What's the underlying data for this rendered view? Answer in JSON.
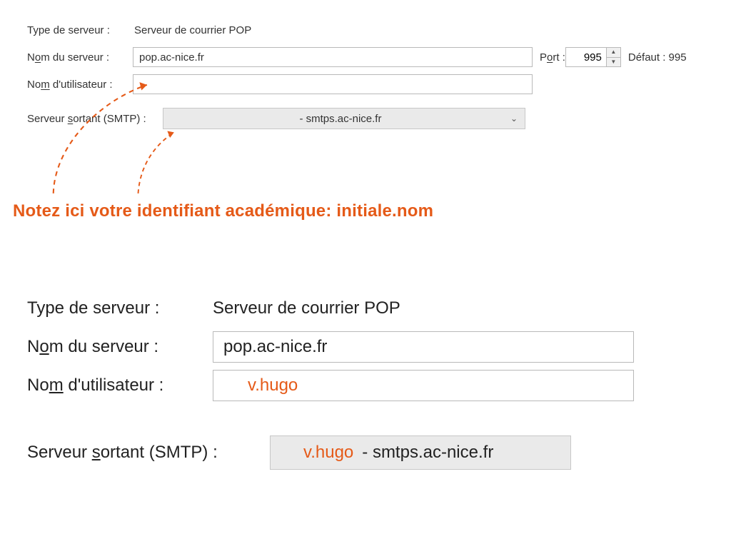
{
  "top": {
    "server_type_label": "Type de serveur :",
    "server_type_value": "Serveur de courrier POP",
    "server_name_label_pre": "N",
    "server_name_label_under": "o",
    "server_name_label_post": "m du serveur :",
    "server_name_value": "pop.ac-nice.fr",
    "port_label_pre": "P",
    "port_label_under": "o",
    "port_label_post": "rt :",
    "port_value": "995",
    "default_label": "Défaut : 995",
    "username_label_pre": "No",
    "username_label_under": "m",
    "username_label_post": " d'utilisateur :",
    "username_value": "",
    "smtp_label_pre": "Serveur ",
    "smtp_label_under": "s",
    "smtp_label_post": "ortant (SMTP) :",
    "smtp_value": " - smtps.ac-nice.fr"
  },
  "annotation": "Notez ici votre identifiant académique: initiale.nom",
  "bottom": {
    "server_type_label": "Type de serveur :",
    "server_type_value": "Serveur de courrier POP",
    "server_name_label_pre": "N",
    "server_name_label_under": "o",
    "server_name_label_post": "m du serveur :",
    "server_name_value": "pop.ac-nice.fr",
    "username_label_pre": "No",
    "username_label_under": "m",
    "username_label_post": " d'utilisateur :",
    "username_value": "v.hugo",
    "smtp_label_pre": "Serveur ",
    "smtp_label_under": "s",
    "smtp_label_post": "ortant (SMTP) :",
    "smtp_user": "v.hugo",
    "smtp_rest": "- smtps.ac-nice.fr"
  },
  "colors": {
    "accent": "#e55a18"
  }
}
